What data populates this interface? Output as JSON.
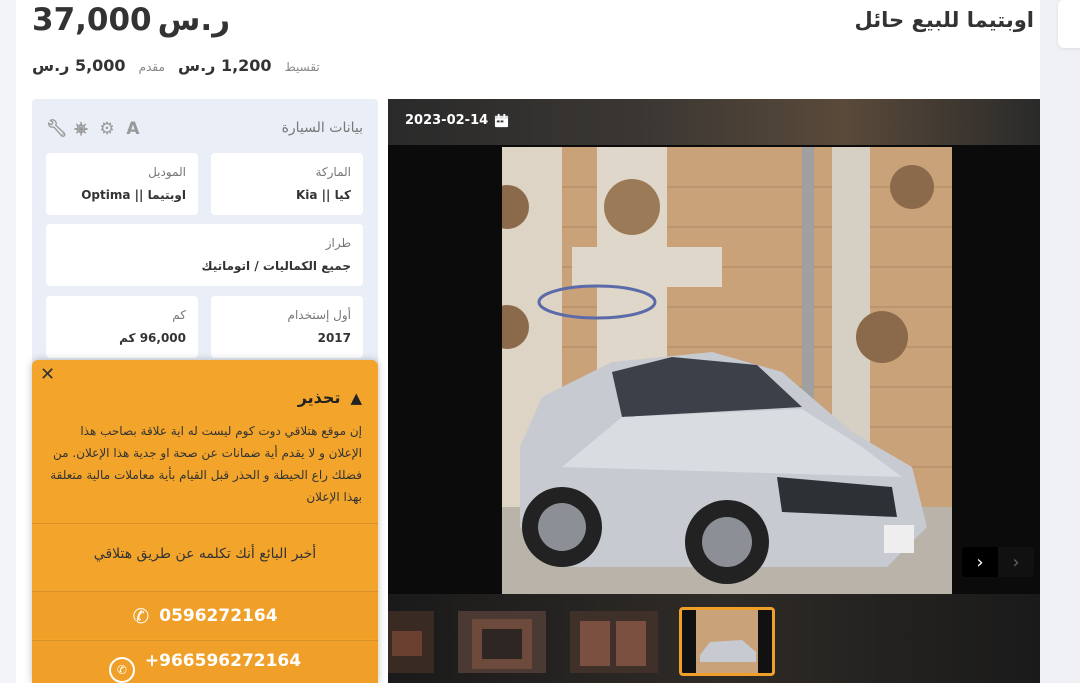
{
  "listing": {
    "title": "اوبتيما للبيع حائل",
    "price": "37,000",
    "currency": "ر.س",
    "installment_label": "تقسيط",
    "installment_value": "1,200 ر.س",
    "down_label": "مقدم",
    "down_value": "5,000 ر.س"
  },
  "car_data": {
    "title": "بيانات السيارة",
    "fields": [
      {
        "label": "الماركة",
        "value": "كيا || Kia"
      },
      {
        "label": "الموديل",
        "value": "اوبتيما || Optima"
      },
      {
        "label": "طراز",
        "value": "جميع الكماليات / اتوماتيك"
      },
      {
        "label": "أول إستخدام",
        "value": "2017"
      },
      {
        "label": "كم",
        "value": "96,000 كم"
      }
    ],
    "icons": [
      "font-icon",
      "cogs-icon",
      "steering-wheel-icon",
      "wrench-icon"
    ]
  },
  "warning": {
    "title": "تحذير",
    "body": "إن موقع هتلاقي دوت كوم ليست له اية علاقة بصاحب هذا الإعلان و لا يقدم أية ضمانات عن صحة او جدية هذا الإعلان. من فضلك راع الحيطة و الحذر قبل القيام بأية معاملات مالية متعلقة بهذا الإعلان",
    "cta": "أخبر البائع أنك تكلمه عن طريق هتلاقي",
    "phone": "0596272164",
    "whatsapp": "+966596272164"
  },
  "gallery": {
    "date": "2023-02-14"
  },
  "colors": {
    "accent": "#f3a52b",
    "panel_bg": "#e9eef7"
  }
}
